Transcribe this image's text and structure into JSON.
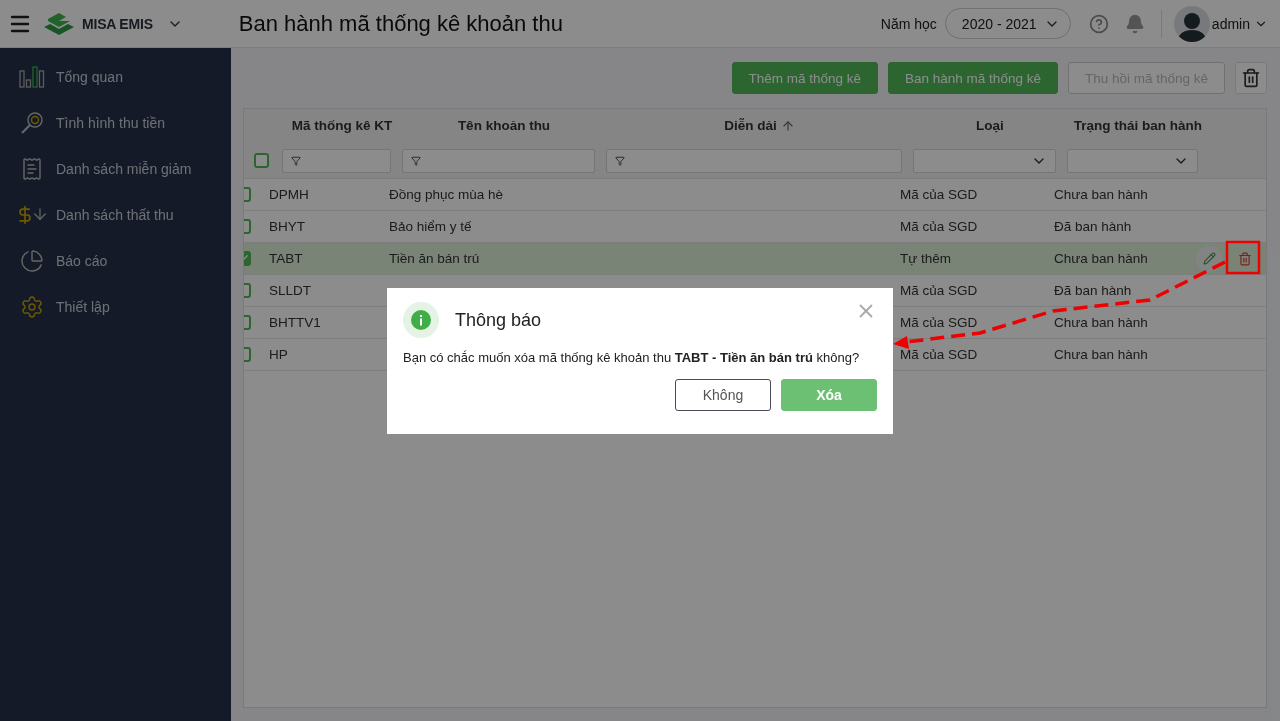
{
  "topbar": {
    "app_name": "MISA EMIS",
    "page_title": "Ban hành mã thống kê khoản thu",
    "year_label": "Năm học",
    "year_value": "2020 - 2021",
    "user": "admin"
  },
  "sidebar": {
    "items": [
      {
        "label": "Tổng quan"
      },
      {
        "label": "Tình hình thu tiền"
      },
      {
        "label": "Danh sách miễn giảm"
      },
      {
        "label": "Danh sách thất thu"
      },
      {
        "label": "Báo cáo"
      },
      {
        "label": "Thiết lập"
      }
    ]
  },
  "toolbar": {
    "buttons": [
      {
        "label": "Thêm mã thống kê",
        "disabled": false
      },
      {
        "label": "Ban hành mã thống kê",
        "disabled": false
      },
      {
        "label": "Thu hồi mã thống kê",
        "disabled": true
      }
    ]
  },
  "table": {
    "all_checked": false,
    "columns": [
      {
        "label": "Mã thống kê KT",
        "kind": "text",
        "sorted": false
      },
      {
        "label": "Tên khoản thu",
        "kind": "text",
        "sorted": false
      },
      {
        "label": "Diễn dải",
        "kind": "text",
        "sorted": true
      },
      {
        "label": "Loại",
        "kind": "select",
        "sorted": false
      },
      {
        "label": "Trạng thái ban hành",
        "kind": "select",
        "sorted": false
      }
    ],
    "rows": [
      {
        "code": "DPMH",
        "name": "Đồng phục mùa hè",
        "type": "Mã của SGD",
        "status": "Chưa ban hành",
        "checked": false
      },
      {
        "code": "BHYT",
        "name": "Bảo hiểm y tế",
        "type": "Mã của SGD",
        "status": "Đã ban hành",
        "checked": false
      },
      {
        "code": "TABT",
        "name": "Tiền ăn bán trú",
        "type": "Tự thêm",
        "status": "Chưa ban hành",
        "checked": true
      },
      {
        "code": "SLLDT",
        "type": "Mã của SGD",
        "status": "Đã ban hành",
        "checked": false
      },
      {
        "code": "BHTTV1",
        "type": "Mã của SGD",
        "status": "Chưa ban hành",
        "checked": false
      },
      {
        "code": "HP",
        "type": "Mã của SGD",
        "status": "Chưa ban hành",
        "checked": false
      }
    ]
  },
  "dialog": {
    "title": "Thông báo",
    "message": "Bạn có chắc muốn xóa mã thống kê khoản thu **TABT - Tiền ăn bán trú** không?",
    "buttons": [
      {
        "label": "Không",
        "kind": "secondary"
      },
      {
        "label": "Xóa",
        "kind": "primary"
      }
    ]
  }
}
